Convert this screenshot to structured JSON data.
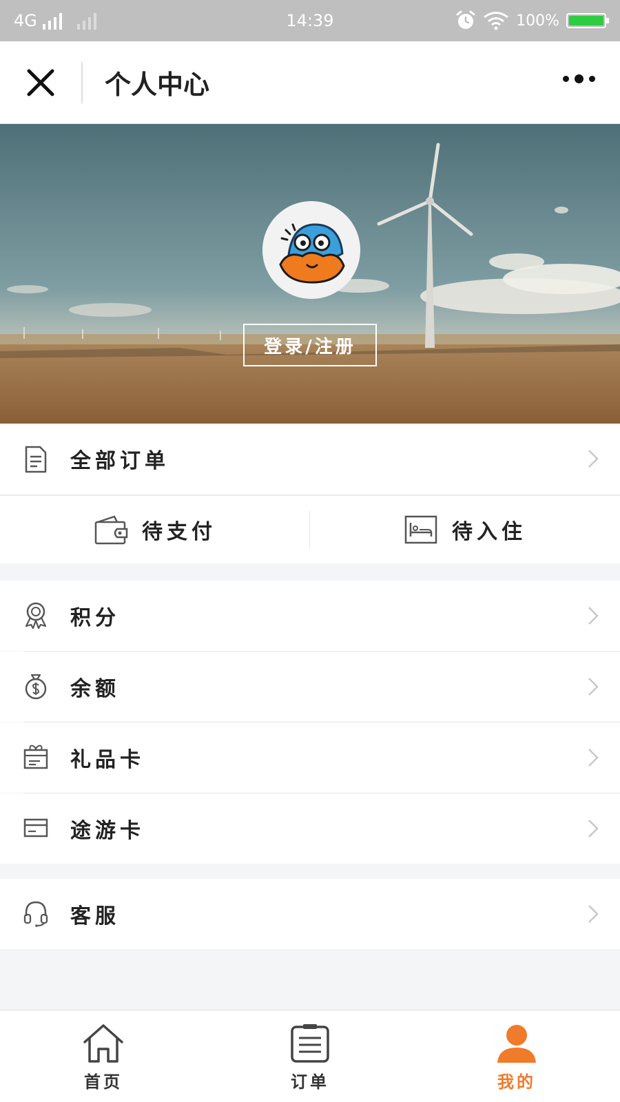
{
  "status_bar": {
    "network": "4G",
    "time": "14:39",
    "battery": "100%"
  },
  "nav": {
    "title": "个人中心"
  },
  "hero": {
    "login_label": "登录/注册"
  },
  "orders": {
    "all_label": "全部订单",
    "pending_payment": "待支付",
    "pending_checkin": "待入住"
  },
  "menu": {
    "items": [
      {
        "label": "积分",
        "icon": "medal-icon"
      },
      {
        "label": "余额",
        "icon": "money-bag-icon"
      },
      {
        "label": "礼品卡",
        "icon": "gift-card-icon"
      },
      {
        "label": "途游卡",
        "icon": "credit-card-icon"
      }
    ],
    "service": {
      "label": "客服",
      "icon": "headset-icon"
    }
  },
  "tabbar": {
    "tabs": [
      {
        "label": "首页",
        "icon": "home-icon"
      },
      {
        "label": "订单",
        "icon": "order-list-icon"
      },
      {
        "label": "我的",
        "icon": "person-icon"
      }
    ],
    "active_index": 2
  },
  "colors": {
    "accent": "#f07b2a",
    "tab_inactive": "#333333",
    "status_bar": "#bfbfbf"
  }
}
